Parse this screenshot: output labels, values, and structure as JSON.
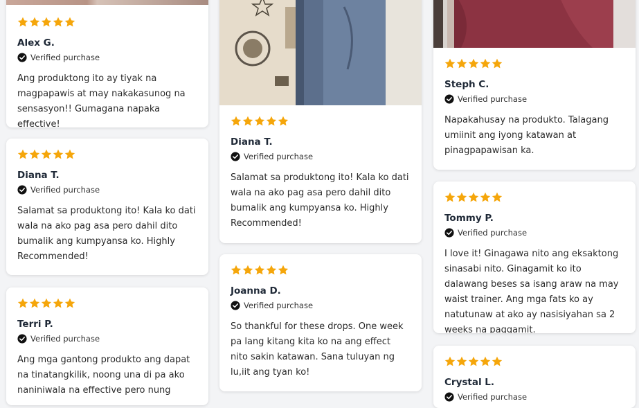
{
  "star_color": "#f5a60b",
  "verified_label": "Verified purchase",
  "reviews": [
    {
      "name": "Alex G.",
      "rating": 5,
      "text": "Ang produktong ito ay tiyak na magpapawis at may nakakasunog na sensasyon!! Gumagana napaka effective!"
    },
    {
      "name": "Diana T.",
      "rating": 5,
      "text": "Salamat sa produktong ito! Kala ko dati wala na ako pag asa pero dahil dito bumalik ang kumpyansa ko. Highly Recommended!"
    },
    {
      "name": "Terri P.",
      "rating": 5,
      "text": "Ang mga gantong produkto ang dapat na tinatangkilik, noong una di pa ako naniniwala na effective pero nung"
    },
    {
      "name": "Diana T.",
      "rating": 5,
      "text": "Salamat sa produktong ito! Kala ko dati wala na ako pag asa pero dahil dito bumalik ang kumpyansa ko. Highly Recommended!"
    },
    {
      "name": "Joanna D.",
      "rating": 5,
      "text": "So thankful for these drops. One week pa lang kitang kita ko na ang effect nito sakin katawan. Sana tuluyan ng lu,iit ang tyan ko!"
    },
    {
      "name": "Steph C.",
      "rating": 5,
      "text": "Napakahusay na produkto. Talagang umiinit ang iyong katawan at pinagpapawisan ka."
    },
    {
      "name": "Tommy P.",
      "rating": 5,
      "text": "I love it! Ginagawa nito ang eksaktong sinasabi nito. Ginagamit ko ito dalawang beses sa isang araw na may waist trainer. Ang mga fats ko ay natutunaw at ako ay nasisiyahan sa 2 weeks na paggamit."
    },
    {
      "name": "Crystal L.",
      "rating": 5,
      "text": ""
    }
  ]
}
